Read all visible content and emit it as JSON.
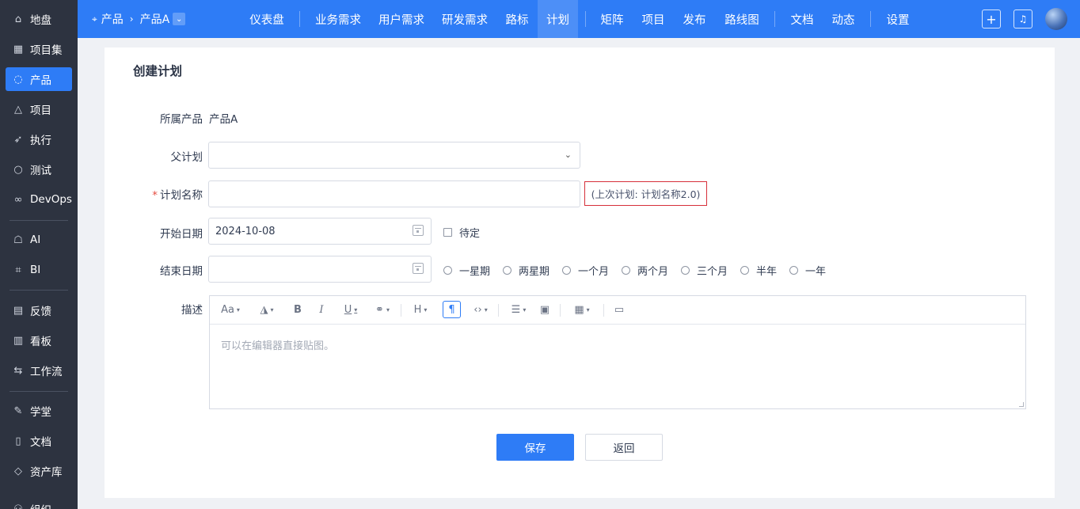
{
  "sidebar": {
    "items": [
      {
        "label": "地盘",
        "icon": "home-icon"
      },
      {
        "label": "项目集",
        "icon": "grid-icon"
      },
      {
        "label": "产品",
        "icon": "lightbulb-icon",
        "active": true
      },
      {
        "label": "项目",
        "icon": "rocket-icon"
      },
      {
        "label": "执行",
        "icon": "run-icon"
      },
      {
        "label": "测试",
        "icon": "bug-search-icon"
      },
      {
        "label": "DevOps",
        "icon": "infinity-icon"
      },
      {
        "label": "AI",
        "icon": "robot-icon"
      },
      {
        "label": "BI",
        "icon": "chart-icon"
      },
      {
        "label": "反馈",
        "icon": "feedback-icon"
      },
      {
        "label": "看板",
        "icon": "kanban-icon"
      },
      {
        "label": "工作流",
        "icon": "workflow-icon"
      },
      {
        "label": "学堂",
        "icon": "school-icon"
      },
      {
        "label": "文档",
        "icon": "document-icon"
      },
      {
        "label": "资产库",
        "icon": "diamond-icon"
      },
      {
        "label": "组织",
        "icon": "org-icon"
      }
    ]
  },
  "topbar": {
    "breadcrumb_root": "产品",
    "breadcrumb_current": "产品A",
    "nav": [
      {
        "label": "仪表盘"
      },
      {
        "label": "业务需求"
      },
      {
        "label": "用户需求"
      },
      {
        "label": "研发需求"
      },
      {
        "label": "路标"
      },
      {
        "label": "计划",
        "active": true
      },
      {
        "label": "矩阵"
      },
      {
        "label": "项目"
      },
      {
        "label": "发布"
      },
      {
        "label": "路线图"
      },
      {
        "label": "文档"
      },
      {
        "label": "动态"
      },
      {
        "label": "设置"
      }
    ],
    "accent_color": "#2e7cf6"
  },
  "form": {
    "title": "创建计划",
    "product_label": "所属产品",
    "product_value": "产品A",
    "parent_label": "父计划",
    "parent_value": "",
    "name_required_mark": "*",
    "name_label": "计划名称",
    "name_value": "",
    "name_hint": "(上次计划: 计划名称2.0)",
    "start_label": "开始日期",
    "start_value": "2024-10-08",
    "pending_label": "待定",
    "end_label": "结束日期",
    "end_value": "",
    "durations": [
      "一星期",
      "两星期",
      "一个月",
      "两个月",
      "三个月",
      "半年",
      "一年"
    ],
    "desc_label": "描述",
    "editor_placeholder": "可以在编辑器直接贴图。",
    "save_label": "保存",
    "back_label": "返回"
  }
}
